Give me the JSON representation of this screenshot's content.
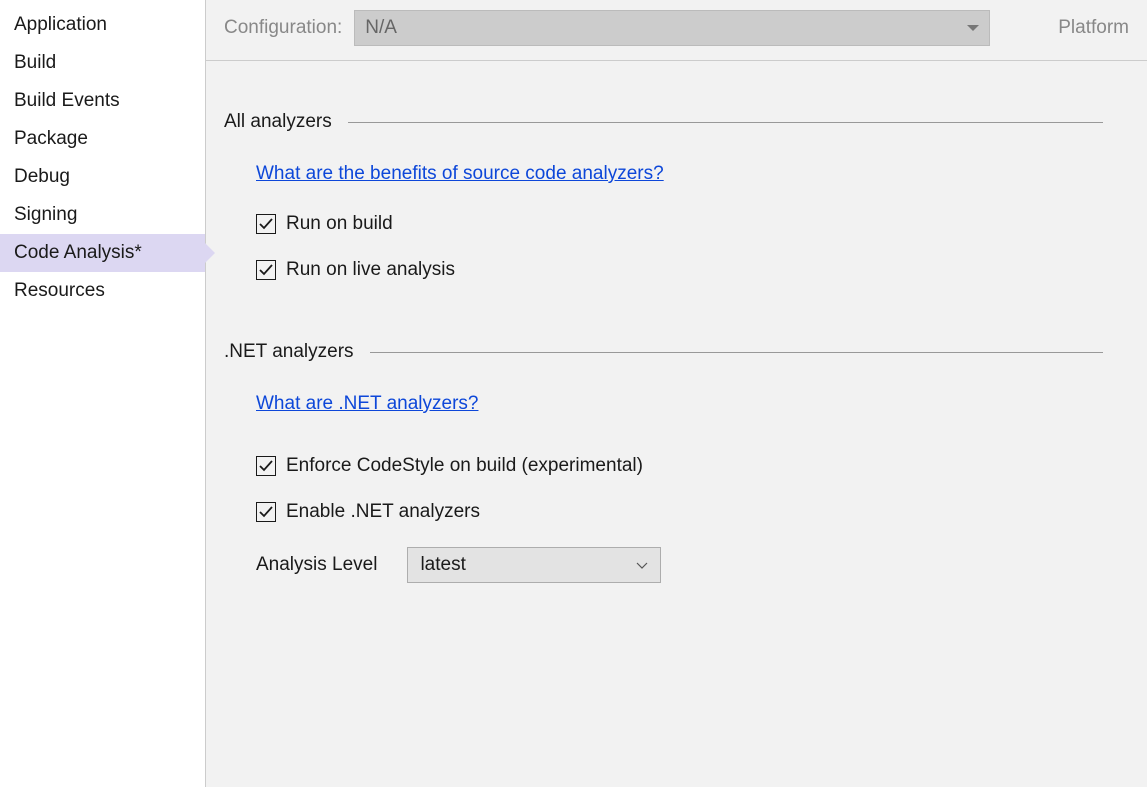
{
  "sidebar": {
    "items": [
      {
        "label": "Application"
      },
      {
        "label": "Build"
      },
      {
        "label": "Build Events"
      },
      {
        "label": "Package"
      },
      {
        "label": "Debug"
      },
      {
        "label": "Signing"
      },
      {
        "label": "Code Analysis*"
      },
      {
        "label": "Resources"
      }
    ],
    "selected_index": 6
  },
  "header": {
    "configuration_label": "Configuration:",
    "configuration_value": "N/A",
    "platform_label": "Platform"
  },
  "sections": {
    "all_analyzers": {
      "title": "All analyzers",
      "link": "What are the benefits of source code analyzers?",
      "run_on_build": {
        "label": "Run on build",
        "checked": true
      },
      "run_on_live": {
        "label": "Run on live analysis",
        "checked": true
      }
    },
    "net_analyzers": {
      "title": ".NET analyzers",
      "link": "What are .NET analyzers?",
      "enforce_codestyle": {
        "label": "Enforce CodeStyle on build (experimental)",
        "checked": true
      },
      "enable_net": {
        "label": "Enable .NET analyzers",
        "checked": true
      },
      "analysis_level_label": "Analysis Level",
      "analysis_level_value": "latest"
    }
  }
}
